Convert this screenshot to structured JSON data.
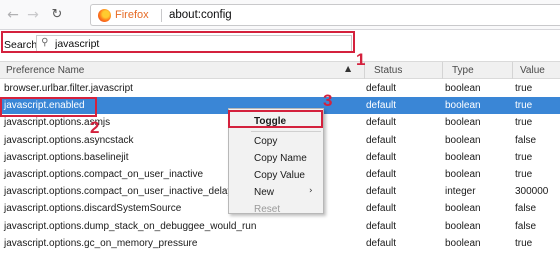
{
  "browser": {
    "brand": "Firefox",
    "url": "about:config",
    "icons": {
      "back": "back-arrow-icon",
      "forward": "forward-arrow-icon",
      "reload": "reload-icon",
      "logo": "firefox-logo-icon"
    }
  },
  "search": {
    "label": "Search:",
    "value": "javascript",
    "icon": "search-icon"
  },
  "table": {
    "headers": {
      "name": "Preference Name",
      "status": "Status",
      "type": "Type",
      "value": "Value"
    },
    "sort_icon": "sort-ascending-icon",
    "rows": [
      {
        "name": "browser.urlbar.filter.javascript",
        "status": "default",
        "type": "boolean",
        "value": "true"
      },
      {
        "name": "javascript.enabled",
        "status": "default",
        "type": "boolean",
        "value": "true",
        "selected": true
      },
      {
        "name": "javascript.options.asmjs",
        "status": "default",
        "type": "boolean",
        "value": "true"
      },
      {
        "name": "javascript.options.asyncstack",
        "status": "default",
        "type": "boolean",
        "value": "false"
      },
      {
        "name": "javascript.options.baselinejit",
        "status": "default",
        "type": "boolean",
        "value": "true"
      },
      {
        "name": "javascript.options.compact_on_user_inactive",
        "status": "default",
        "type": "boolean",
        "value": "true"
      },
      {
        "name": "javascript.options.compact_on_user_inactive_delay",
        "status": "default",
        "type": "integer",
        "value": "300000"
      },
      {
        "name": "javascript.options.discardSystemSource",
        "status": "default",
        "type": "boolean",
        "value": "false"
      },
      {
        "name": "javascript.options.dump_stack_on_debuggee_would_run",
        "status": "default",
        "type": "boolean",
        "value": "false"
      },
      {
        "name": "javascript.options.gc_on_memory_pressure",
        "status": "default",
        "type": "boolean",
        "value": "true"
      }
    ]
  },
  "context_menu": {
    "toggle": "Toggle",
    "copy": "Copy",
    "copy_name": "Copy Name",
    "copy_value": "Copy Value",
    "new": "New",
    "reset": "Reset",
    "submenu_icon": "chevron-right-icon"
  },
  "annotations": {
    "step1": "1",
    "step2": "2",
    "step3": "3",
    "color": "#d4213d"
  },
  "colors": {
    "selection": "#3a86d6",
    "brand": "#e66a24"
  }
}
